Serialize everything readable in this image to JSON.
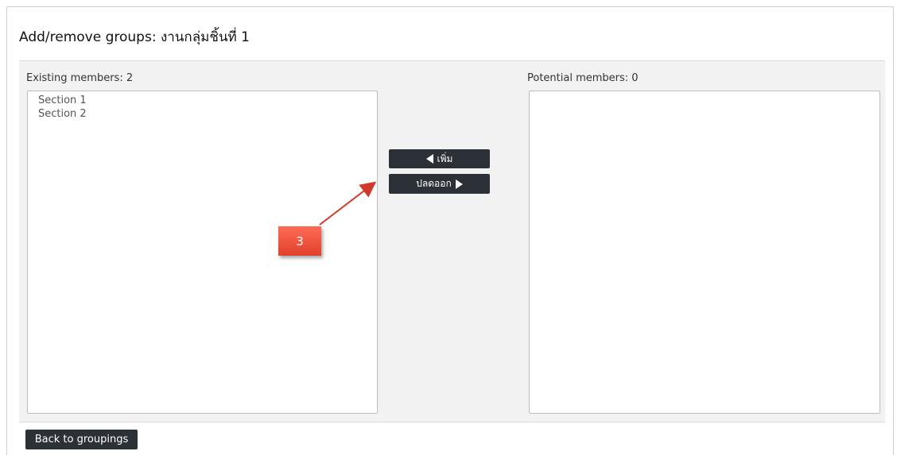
{
  "page": {
    "title": "Add/remove groups: งานกลุ่มชิ้นที่ 1"
  },
  "existing": {
    "label": "Existing members: 2",
    "options": [
      "Section 1",
      "Section 2"
    ]
  },
  "potential": {
    "label": "Potential members: 0",
    "options": []
  },
  "actions": {
    "add_label": "เพิ่ม",
    "remove_label": "ปลดออก",
    "back_label": "Back to groupings"
  },
  "annotation": {
    "step_number": "3",
    "color": "#e0412b"
  },
  "colors": {
    "button_bg": "#2b3136",
    "panel_bg": "#f2f2f2"
  }
}
